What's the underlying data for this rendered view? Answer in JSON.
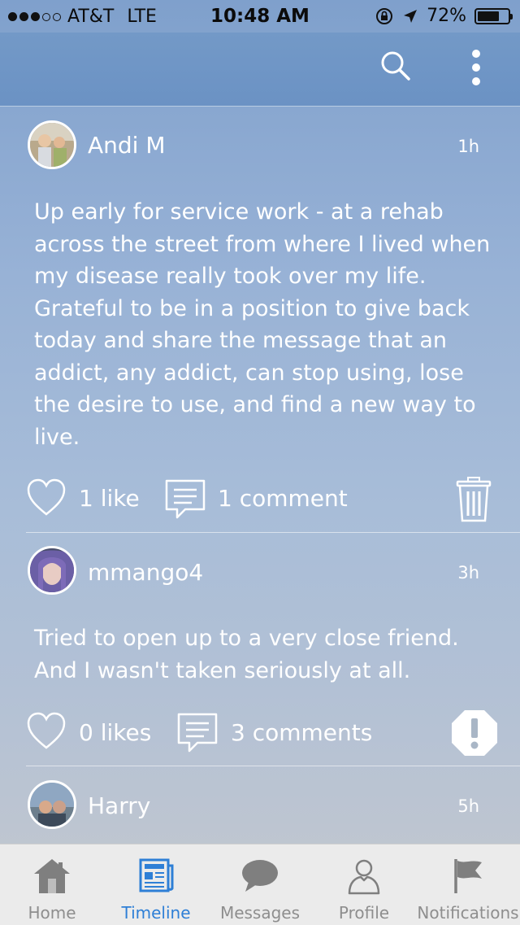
{
  "status_bar": {
    "carrier": "AT&T",
    "network": "LTE",
    "time": "10:48 AM",
    "battery": "72%",
    "battery_level": 0.72,
    "signal_bars_filled": 3,
    "signal_bars_total": 5
  },
  "app_bar": {
    "icons": [
      "search-icon",
      "more-vertical-icon"
    ]
  },
  "posts": [
    {
      "author": "Andi M",
      "time": "1h",
      "text": "Up early for service work - at a rehab across the street from where I lived when my disease really took over my life. Grateful to be in a position to give back today and share the message that an addict, any addict, can stop using, lose the desire to use, and find a new way to live.",
      "likes": "1 like",
      "comments": "1 comment",
      "action_icon": "trash-icon"
    },
    {
      "author": "mmango4",
      "time": "3h",
      "text": "Tried to open up to a very close friend. And I wasn't taken seriously at all.",
      "likes": "0 likes",
      "comments": "3 comments",
      "action_icon": "report-icon"
    },
    {
      "author": "Harry",
      "time": "5h"
    }
  ],
  "tab_bar": {
    "active": "Timeline",
    "tabs": [
      {
        "label": "Home",
        "icon": "home-icon"
      },
      {
        "label": "Timeline",
        "icon": "newspaper-icon"
      },
      {
        "label": "Messages",
        "icon": "chat-bubble-icon"
      },
      {
        "label": "Profile",
        "icon": "person-icon"
      },
      {
        "label": "Notifications",
        "icon": "flag-icon"
      }
    ]
  },
  "colors": {
    "accent": "#2e7fd6",
    "app_bar": "#6f96c6",
    "tab_inactive": "#8e8e8e"
  }
}
